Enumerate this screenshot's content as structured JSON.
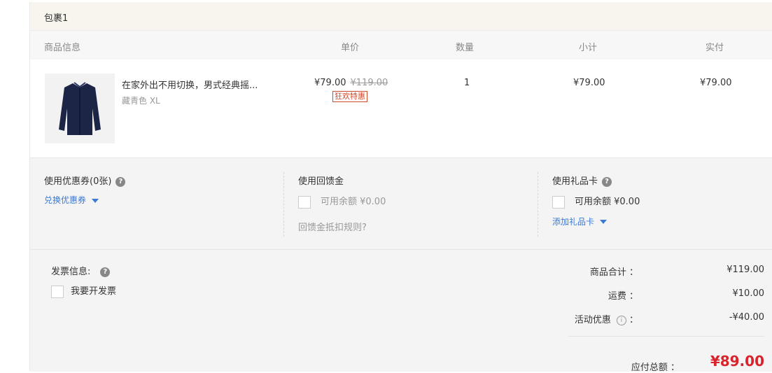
{
  "package": {
    "title": "包裹1"
  },
  "columns": {
    "info": "商品信息",
    "unit_price": "单价",
    "quantity": "数量",
    "subtotal": "小计",
    "paid": "实付"
  },
  "item": {
    "name": "在家外出不用切换，男式经典摇...",
    "spec": "藏青色 XL",
    "price": "¥79.00",
    "original_price": "¥119.00",
    "promo_tag": "狂欢特惠",
    "quantity": "1",
    "subtotal": "¥79.00",
    "paid": "¥79.00",
    "image_icon": "jacket-icon",
    "image_color": "#1c2546"
  },
  "coupon": {
    "title": "使用优惠券(0张)",
    "link": "兑换优惠券"
  },
  "rebate": {
    "title": "使用回馈金",
    "balance": "可用余额 ¥0.00",
    "rule": "回馈金抵扣规则?"
  },
  "giftcard": {
    "title": "使用礼品卡",
    "balance": "可用余额 ¥0.00",
    "link": "添加礼品卡"
  },
  "invoice": {
    "title": "发票信息:",
    "checkbox_label": "我要开发票"
  },
  "summary": {
    "goods_label": "商品合计 ：",
    "goods_value": "¥119.00",
    "shipping_label": "运费 ：",
    "shipping_value": "¥10.00",
    "discount_label": "活动优惠",
    "discount_colon": "：",
    "discount_value": "-¥40.00",
    "total_label": "应付总额 ：",
    "total_value": "¥89.00"
  },
  "colors": {
    "accent_red": "#d9232d",
    "link_blue": "#3b79d4",
    "header_bg": "#f8f5ee"
  }
}
